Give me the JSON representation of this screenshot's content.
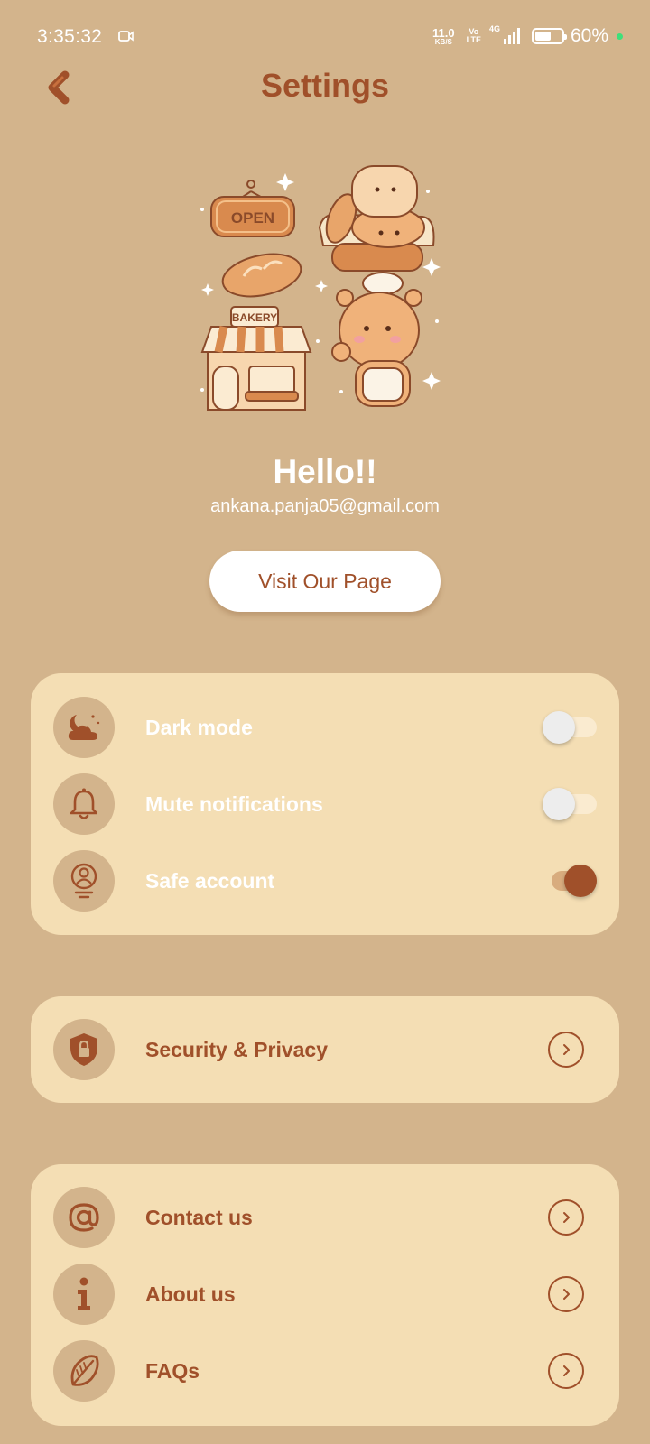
{
  "status_bar": {
    "time": "3:35:32",
    "net_speed_value": "11.0",
    "net_speed_unit": "KB/S",
    "volte_top": "Vo",
    "volte_bottom": "LTE",
    "network_label": "4G",
    "battery_percent": "60%",
    "battery_level": 0.6
  },
  "header": {
    "title": "Settings",
    "back_icon": "back-arrow-icon"
  },
  "profile": {
    "greeting": "Hello!!",
    "email": "ankana.panja05@gmail.com",
    "visit_button": "Visit Our Page",
    "illustration_text": [
      "OPEN",
      "BAKERY"
    ]
  },
  "toggles": [
    {
      "label": "Dark mode",
      "icon": "night-cloud-icon",
      "state": "off"
    },
    {
      "label": "Mute notifications",
      "icon": "bell-icon",
      "state": "off"
    },
    {
      "label": "Safe account",
      "icon": "account-icon",
      "state": "on"
    }
  ],
  "security": {
    "label": "Security & Privacy",
    "icon": "shield-lock-icon"
  },
  "links": [
    {
      "label": "Contact us",
      "icon": "at-sign-icon"
    },
    {
      "label": "About us",
      "icon": "info-icon"
    },
    {
      "label": "FAQs",
      "icon": "leaf-icon"
    }
  ],
  "colors": {
    "background": "#D3B48C",
    "card": "#F4DEB4",
    "accent": "#A0502A",
    "white": "#FFFFFF"
  }
}
